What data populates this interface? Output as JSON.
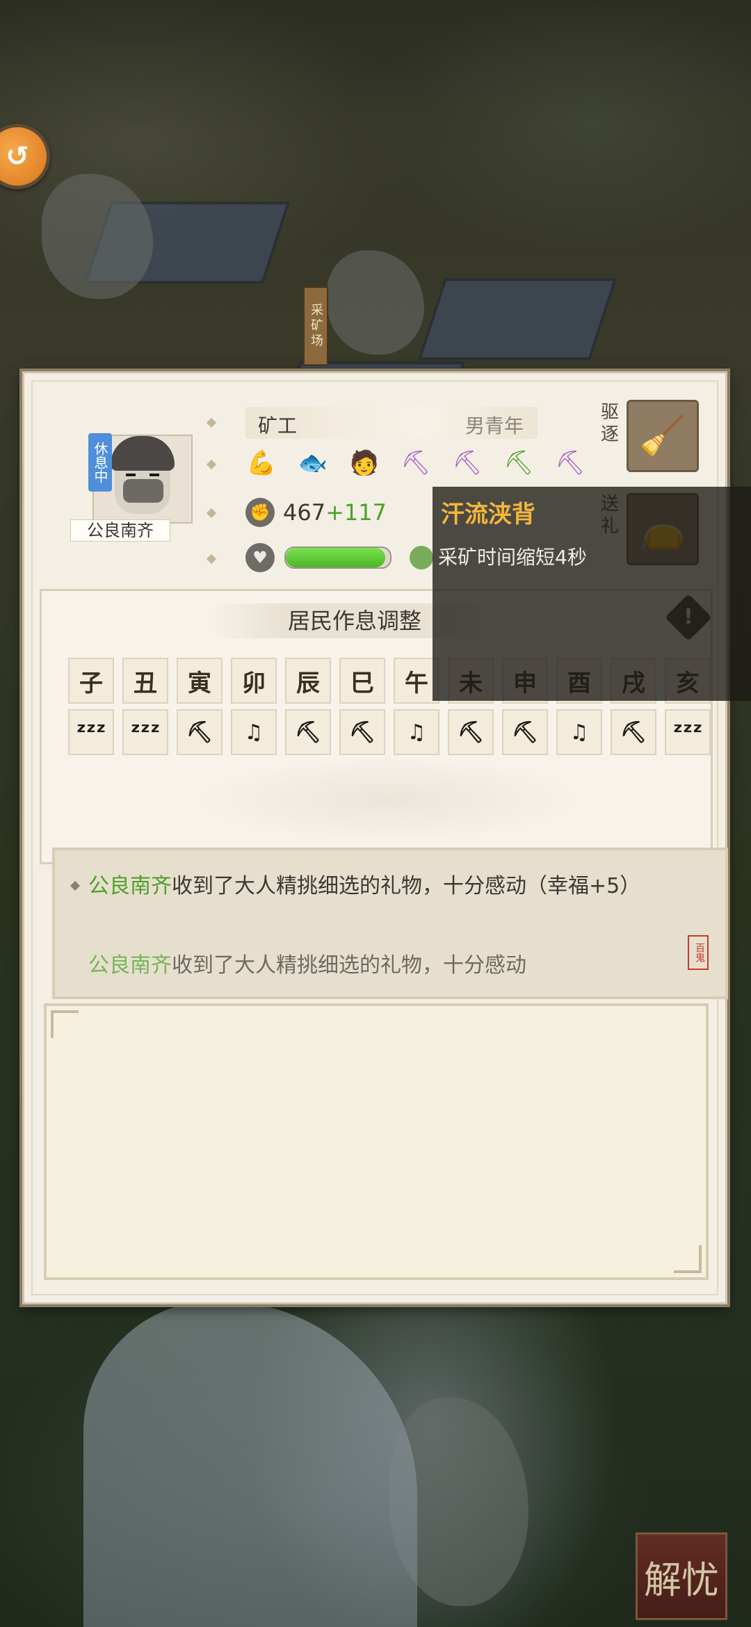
{
  "map": {
    "mine_sign": "采矿场",
    "top_button_icon": "arrow-icon"
  },
  "resident": {
    "status_badge": "休息中",
    "name": "公良南齐",
    "job": "矿工",
    "age_gender": "男青年",
    "traits": [
      {
        "icon": "muscle-icon",
        "glyph": "💪",
        "color": "#4aa128"
      },
      {
        "icon": "fish-icon",
        "glyph": "🐟",
        "color": "#3a9bd0"
      },
      {
        "icon": "chef-icon",
        "glyph": "🧑",
        "color": "#a658c8"
      },
      {
        "icon": "pick-pot-icon",
        "glyph": "⛏",
        "color": "#a658c8"
      },
      {
        "icon": "pickaxe-icon",
        "glyph": "⛏",
        "color": "#a658c8"
      },
      {
        "icon": "pickaxe-green-icon",
        "glyph": "⛏",
        "color": "#4aa128"
      },
      {
        "icon": "pick-pot-icon-2",
        "glyph": "⛏",
        "color": "#a658c8"
      }
    ],
    "stat_base": "467",
    "stat_bonus": "+117",
    "happiness_fraction": 0.95
  },
  "side_buttons": {
    "expel_label": "驱逐",
    "gift_label": "送礼"
  },
  "tooltip": {
    "title": "汗流浃背",
    "description": "采矿时间缩短4秒"
  },
  "schedule": {
    "title": "居民作息调整",
    "hours": [
      "子",
      "丑",
      "寅",
      "卯",
      "辰",
      "巳",
      "午",
      "未",
      "申",
      "酉",
      "戌",
      "亥"
    ],
    "activities": [
      {
        "type": "sleep",
        "glyph": "ᶻᶻᶻ"
      },
      {
        "type": "sleep",
        "glyph": "ᶻᶻᶻ"
      },
      {
        "type": "work",
        "glyph": "⛏"
      },
      {
        "type": "leisure",
        "glyph": "♫"
      },
      {
        "type": "work",
        "glyph": "⛏"
      },
      {
        "type": "work",
        "glyph": "⛏"
      },
      {
        "type": "leisure",
        "glyph": "♫"
      },
      {
        "type": "work",
        "glyph": "⛏"
      },
      {
        "type": "work",
        "glyph": "⛏"
      },
      {
        "type": "leisure",
        "glyph": "♫"
      },
      {
        "type": "work",
        "glyph": "⛏"
      },
      {
        "type": "sleep",
        "glyph": "ᶻᶻᶻ"
      }
    ]
  },
  "log": {
    "entry1_name": "公良南齐",
    "entry1_text": "收到了大人精挑细选的礼物，十分感动（幸福+5）",
    "entry2_name": "公良南齐",
    "entry2_text": "收到了大人精挑细选的礼物，十分感动",
    "seal": "百鬼"
  },
  "bottom_button": {
    "label": "解忧"
  }
}
